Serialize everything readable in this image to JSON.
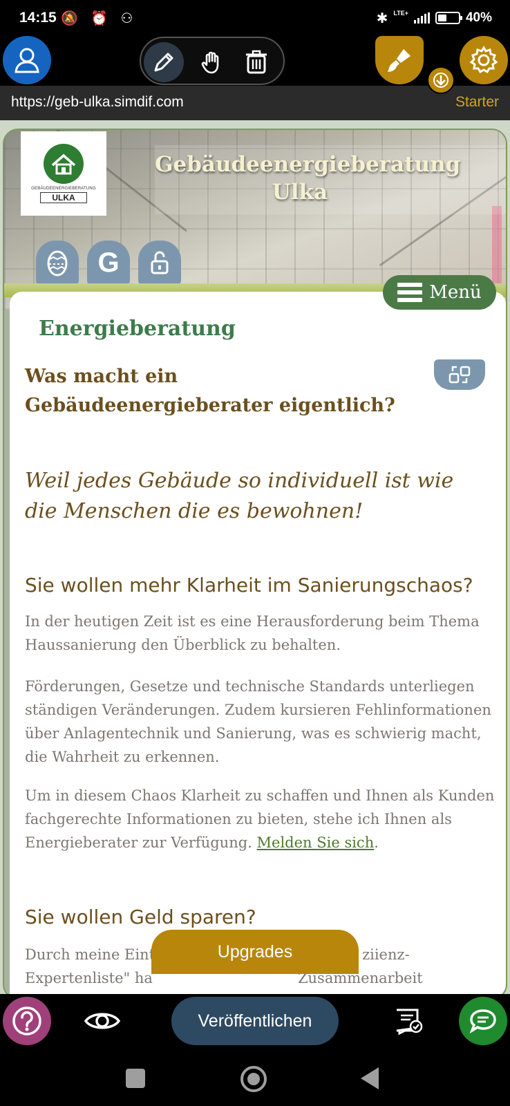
{
  "status_bar": {
    "time": "14:15",
    "left_icons": "🔕 ⏰ ⚇",
    "network": "LTE+",
    "battery": "40%"
  },
  "toolbar": {
    "user_icon": "user-icon",
    "tools": [
      "edit-pencil-icon",
      "hand-icon",
      "trash-icon"
    ],
    "active_tool": "edit-pencil-icon",
    "brush_icon": "paint-brush-icon",
    "settings_icon": "gear-icon",
    "starter_icon": "download-arrow-icon",
    "accent_color": "#b8860b"
  },
  "url_bar": {
    "url": "https://geb-ulka.simdif.com",
    "plan_label": "Starter"
  },
  "site": {
    "logo": {
      "ring_text": "GEBÄUDEENERGIEBERATUNG",
      "name": "ULKA"
    },
    "title": "Gebäudeenergieberatung Ulka",
    "header_icons": [
      "easter-egg-icon",
      "google-icon",
      "unlock-icon"
    ],
    "google_glyph": "G",
    "menu_label": "Menü",
    "page_heading": "Energieberatung",
    "question_heading": "Was macht ein Gebäudeenergieberater eigentlich?",
    "quote": "Weil jedes Gebäude so individuell ist wie die Menschen die es bewohnen!",
    "section1": {
      "heading": "Sie wollen mehr Klarheit im Sanierungschaos?",
      "p1": "In der heutigen Zeit ist es eine Herausforderung beim Thema Haussanierung den Überblick zu behalten.",
      "p2": "Förderungen, Gesetze und technische Standards unterliegen ständigen Veränderungen. Zudem kursieren Fehlinformationen über Anlagentechnik und Sanierung, was es schwierig macht, die Wahrheit zu erkennen.",
      "p3_text": "Um in diesem Chaos Klarheit zu schaffen und Ihnen als Kunden fachgerechte Informationen zu bieten, stehe ich Ihnen als Energieberater zur Verfügung. ",
      "p3_link": "Melden Sie sich",
      "p3_end": "."
    },
    "section2": {
      "heading": "Sie wollen Geld sparen?",
      "p1_start": "Durch meine Eint",
      "p1_end": "ziienz-",
      "p2_start": "Expertenliste\" ha",
      "p2_end": "Zusammenarbeit"
    },
    "heading_color": "#6b4f1e",
    "accent_green": "#3d7b4b"
  },
  "upgrades_label": "Upgrades",
  "bottom_bar": {
    "help_icon": "help-icon",
    "preview_icon": "eye-icon",
    "publish_label": "Veröffentlichen",
    "review_icon": "review-checklist-icon",
    "chat_icon": "chat-icon"
  },
  "nav_bar": [
    "recents-icon",
    "home-icon",
    "back-icon"
  ]
}
